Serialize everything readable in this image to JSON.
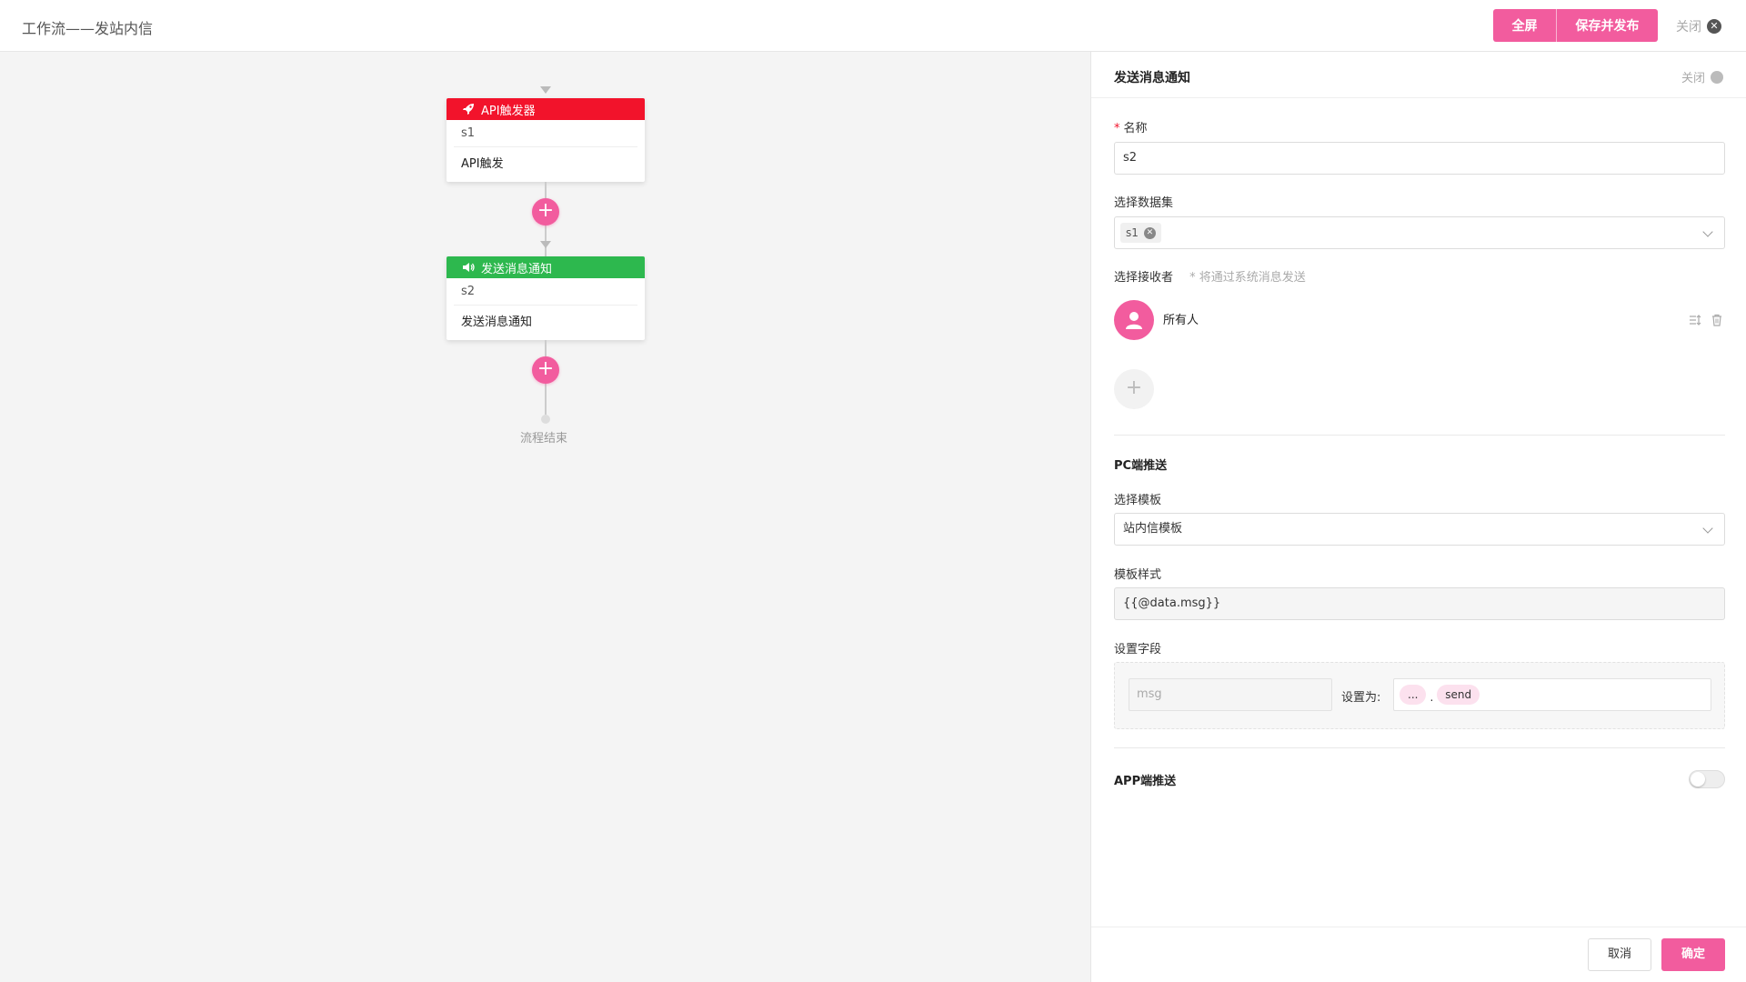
{
  "page_title": "工作流——发站内信",
  "toolbar": {
    "fullscreen_label": "全屏",
    "save_label": "保存并发布",
    "close_label": "关闭"
  },
  "canvas": {
    "nodes": [
      {
        "title": "API触发器",
        "id": "s1",
        "desc": "API触发",
        "color": "#f2132b",
        "icon": "rocket-icon"
      },
      {
        "title": "发送消息通知",
        "id": "s2",
        "desc": "发送消息通知",
        "color": "#2db84e",
        "icon": "speaker-icon"
      }
    ],
    "end_label": "流程结束"
  },
  "panel": {
    "title": "发送消息通知",
    "close_label": "关闭",
    "name": {
      "label": "名称",
      "value": "s2"
    },
    "dataset": {
      "label": "选择数据集",
      "tag": "s1"
    },
    "receivers": {
      "label": "选择接收者",
      "hint": "* 将通过系统消息发送",
      "items": [
        {
          "name": "所有人"
        }
      ]
    },
    "pc_push": {
      "section_title": "PC端推送",
      "template_label": "选择模板",
      "template_value": "站内信模板",
      "style_label": "模板样式",
      "style_value": "{{@data.msg}}",
      "fields_label": "设置字段",
      "field_name": "msg",
      "set_as_label": "设置为:",
      "value_tags": [
        "...",
        "send"
      ],
      "separator": "."
    },
    "app_push": {
      "section_title": "APP端推送",
      "enabled": false
    },
    "footer": {
      "cancel_label": "取消",
      "ok_label": "确定"
    }
  },
  "colors": {
    "accent": "#f25c9e",
    "api_node": "#f2132b",
    "msg_node": "#2db84e"
  }
}
